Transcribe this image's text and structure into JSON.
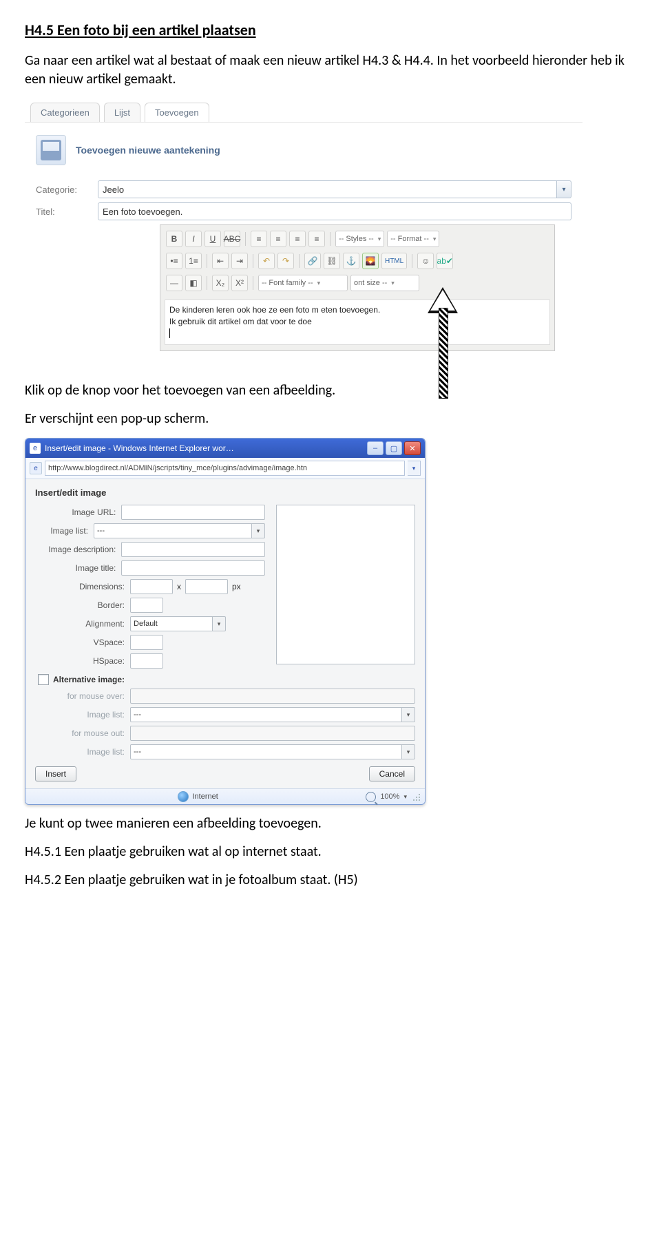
{
  "doc": {
    "heading": "H4.5 Een foto bij een artikel plaatsen",
    "p1": "Ga naar een artikel wat al bestaat of maak een nieuw artikel H4.3 & H4.4. In het voorbeeld hieronder heb ik een nieuw artikel gemaakt.",
    "p2": "Klik op de knop voor het toevoegen van een afbeelding.",
    "p3": "Er verschijnt een pop-up scherm.",
    "p4": "Je kunt op twee manieren een afbeelding toevoegen.",
    "p5": "H4.5.1 Een plaatje gebruiken wat al op internet staat.",
    "p6": "H4.5.2 Een plaatje gebruiken wat in je fotoalbum staat. (H5)"
  },
  "shot1": {
    "tabs": [
      "Categorieen",
      "Lijst",
      "Toevoegen"
    ],
    "section_title": "Toevoegen nieuwe aantekening",
    "labels": {
      "category": "Categorie:",
      "title": "Titel:"
    },
    "category_value": "Jeelo",
    "title_value": "Een foto toevoegen.",
    "toolbar": {
      "styles": "-- Styles --",
      "format": "-- Format --",
      "fontfamily": "-- Font family --",
      "fontsize": "ont size --",
      "html": "HTML"
    },
    "content_line1": "De kinderen leren ook hoe ze een foto m    eten toevoegen.",
    "content_line2": "Ik gebruik dit artikel om dat voor te doe"
  },
  "shot2": {
    "window_title": "Insert/edit image - Windows Internet Explorer wor…",
    "url": "http://www.blogdirect.nl/ADMIN/jscripts/tiny_mce/plugins/advimage/image.htn",
    "dlg_title": "Insert/edit image",
    "labels": {
      "image_url": "Image URL:",
      "image_list": "Image list:",
      "image_desc": "Image description:",
      "image_title": "Image title:",
      "dimensions": "Dimensions:",
      "dim_x": "x",
      "dim_px": "px",
      "border": "Border:",
      "alignment": "Alignment:",
      "vspace": "VSpace:",
      "hspace": "HSpace:",
      "alt_image": "Alternative image:",
      "mouse_over": "for mouse over:",
      "mouse_out": "for mouse out:"
    },
    "values": {
      "image_list": "---",
      "alignment": "Default",
      "image_list2": "---",
      "image_list3": "---"
    },
    "buttons": {
      "insert": "Insert",
      "cancel": "Cancel"
    },
    "status": {
      "zone": "Internet",
      "zoom": "100%"
    }
  }
}
